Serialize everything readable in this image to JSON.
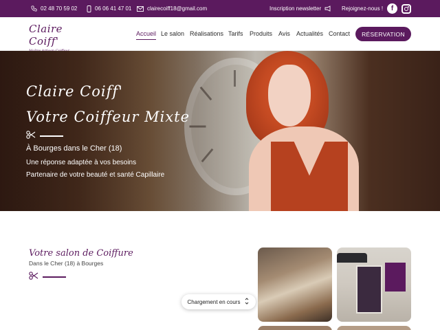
{
  "topbar": {
    "phone1": "02 48 70 59 02",
    "phone2": "06 06 41 47 01",
    "email": "clairecoiff18@gmail.com",
    "newsletter": "Inscription newsletter",
    "join": "Rejoignez-nous !",
    "icons": [
      "phone-icon",
      "mobile-icon",
      "mail-icon",
      "megaphone-icon",
      "facebook-icon",
      "instagram-icon"
    ]
  },
  "logo": {
    "name": "Claire Coiff'",
    "subtitle": "Maître Artisan Coiffeur"
  },
  "nav": {
    "items": [
      "Accueil",
      "Le salon",
      "Réalisations",
      "Tarifs",
      "Produits",
      "Avis",
      "Actualités",
      "Contact"
    ],
    "active": "Accueil",
    "cta": "RÉSERVATION"
  },
  "hero": {
    "title1": "Claire Coiff'",
    "title2": "Votre Coiffeur Mixte",
    "location": "À Bourges dans le Cher (18)",
    "line1": "Une réponse adaptée à vos besoins",
    "line2": "Partenaire de votre beauté et santé Capillaire"
  },
  "section": {
    "title": "Votre salon de Coiffure",
    "subtitle": "Dans le Cher (18) à Bourges"
  },
  "loading": {
    "label": "Chargement en cours"
  },
  "colors": {
    "brand": "#5b1a5e",
    "white": "#ffffff"
  }
}
